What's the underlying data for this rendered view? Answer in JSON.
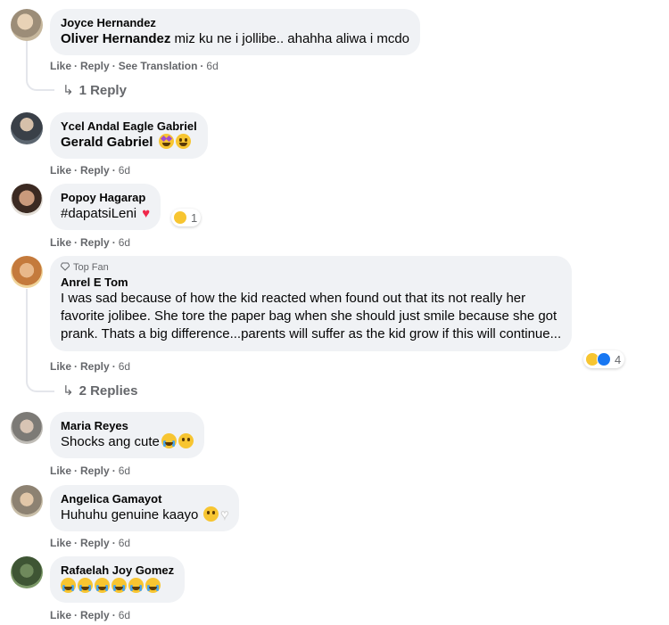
{
  "comments": [
    {
      "avatar_color": "#b8a48c",
      "author": "Joyce Hernandez",
      "mention": "Oliver Hernandez",
      "text": " miz ku ne i jollibe.. ahahha aliwa i mcdo",
      "actions": {
        "like": "Like",
        "reply": "Reply",
        "see_translation": "See Translation",
        "time": "6d"
      },
      "replies_label": "1 Reply"
    },
    {
      "avatar_color": "#4a5560",
      "author": "Ycel Andal Eagle Gabriel",
      "mention": "Gerald Gabriel",
      "text": "",
      "emojis": [
        "star-struck-emoji",
        "grinning-sweat-emoji"
      ],
      "actions": {
        "like": "Like",
        "reply": "Reply",
        "time": "6d"
      }
    },
    {
      "avatar_color": "#7a5a48",
      "author": "Popoy Hagarap",
      "text": "#dapatsiLeni",
      "emojis": [
        "heart-emoji"
      ],
      "reaction": {
        "icons": [
          "haha"
        ],
        "count": "1"
      },
      "actions": {
        "like": "Like",
        "reply": "Reply",
        "time": "6d"
      }
    },
    {
      "avatar_color": "#d9a25e",
      "badge": "Top Fan",
      "author": "Anrel E Tom",
      "text_lines": [
        "I was sad because of how the kid reacted when found out that its not really her",
        "favorite jolibee. She tore the paper bag when she should just smile because she got",
        "prank. Thats a big difference...parents will suffer as the kid grow if this will continue..."
      ],
      "reaction": {
        "icons": [
          "haha",
          "like"
        ],
        "count": "4"
      },
      "actions": {
        "like": "Like",
        "reply": "Reply",
        "time": "6d"
      },
      "replies_label": "2 Replies"
    },
    {
      "avatar_color": "#8a8a86",
      "author": "Maria Reyes",
      "text": "Shocks ang cute",
      "emojis": [
        "crying-emoji",
        "pleading-emoji"
      ],
      "actions": {
        "like": "Like",
        "reply": "Reply",
        "time": "6d"
      }
    },
    {
      "avatar_color": "#a89a84",
      "author": "Angelica Gamayot",
      "text": "Huhuhu genuine kaayo ",
      "emojis": [
        "pleading-emoji",
        "white-heart-emoji"
      ],
      "actions": {
        "like": "Like",
        "reply": "Reply",
        "time": "6d"
      }
    },
    {
      "avatar_color": "#4f6a44",
      "author": "Rafaelah Joy Gomez",
      "text": "",
      "emojis": [
        "crying-emoji",
        "crying-emoji",
        "crying-emoji",
        "crying-emoji",
        "crying-emoji",
        "crying-emoji"
      ],
      "actions": {
        "like": "Like",
        "reply": "Reply",
        "time": "6d"
      }
    }
  ],
  "colors": {
    "bubble": "#f0f2f5",
    "meta_text": "#65676b",
    "thread_line": "#e4e6eb"
  }
}
